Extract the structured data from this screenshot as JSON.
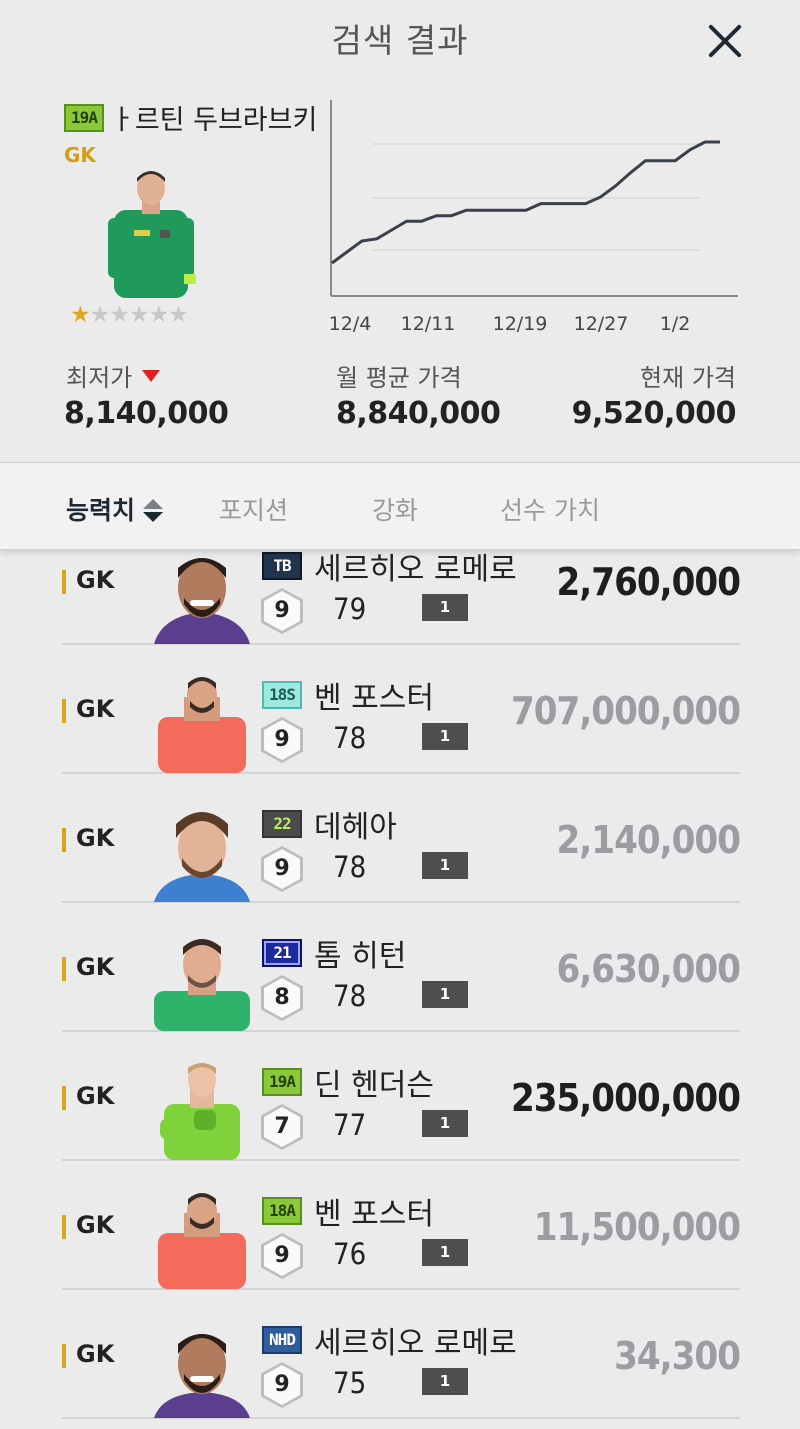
{
  "header": {
    "title": "검색 결과"
  },
  "summary": {
    "season": "19A",
    "name": "ㅏ르틴 두브라브키",
    "position": "GK",
    "stars": 1,
    "stars_max": 6
  },
  "chart_data": {
    "type": "line",
    "x_ticks": [
      "12/4",
      "12/11",
      "12/19",
      "12/27",
      "1/2"
    ],
    "series": [
      {
        "values": [
          7.9,
          8.0,
          8.1,
          8.12,
          8.2,
          8.28,
          8.28,
          8.33,
          8.33,
          8.38,
          8.38,
          8.38,
          8.38,
          8.38,
          8.44,
          8.44,
          8.44,
          8.44,
          8.5,
          8.6,
          8.72,
          8.83,
          8.83,
          8.83,
          8.93,
          9.0,
          9.0
        ]
      }
    ],
    "xlabel": "",
    "ylabel": "",
    "grid": true
  },
  "stats": {
    "min_label": "최저가",
    "min_value": "8,140,000",
    "avg_label": "월 평균 가격",
    "avg_value": "8,840,000",
    "cur_label": "현재 가격",
    "cur_value": "9,520,000"
  },
  "tabs": [
    {
      "label": "능력치"
    },
    {
      "label": "포지션"
    },
    {
      "label": "강화"
    },
    {
      "label": "선수 가치"
    }
  ],
  "results": [
    {
      "position": "GK",
      "season": "TB",
      "name": "세르히오 로메로",
      "grade": "9",
      "ovr": "79",
      "level": "1",
      "price": "2,760,000"
    },
    {
      "position": "GK",
      "season": "18S",
      "name": "벤 포스터",
      "grade": "9",
      "ovr": "78",
      "level": "1",
      "price": "707,000,000"
    },
    {
      "position": "GK",
      "season": "22",
      "name": "데헤아",
      "grade": "9",
      "ovr": "78",
      "level": "1",
      "price": "2,140,000"
    },
    {
      "position": "GK",
      "season": "21",
      "name": "톰 히턴",
      "grade": "8",
      "ovr": "78",
      "level": "1",
      "price": "6,630,000"
    },
    {
      "position": "GK",
      "season": "19A",
      "name": "딘 헨더슨",
      "grade": "7",
      "ovr": "77",
      "level": "1",
      "price": "235,000,000"
    },
    {
      "position": "GK",
      "season": "18A",
      "name": "벤 포스터",
      "grade": "9",
      "ovr": "76",
      "level": "1",
      "price": "11,500,000"
    },
    {
      "position": "GK",
      "season": "NHD",
      "name": "세르히오 로메로",
      "grade": "9",
      "ovr": "75",
      "level": "1",
      "price": "34,300"
    }
  ],
  "colors": {
    "accent_gold": "#d6a51a",
    "price_dark": "#1e1e1e",
    "price_muted": "#9c9ca3",
    "down_arrow": "#e02020"
  }
}
